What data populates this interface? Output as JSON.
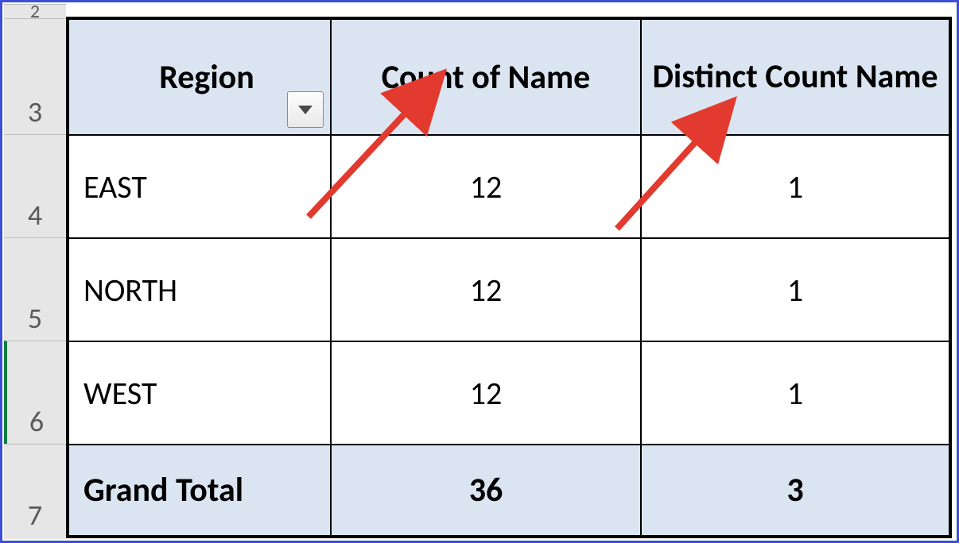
{
  "row_headers": {
    "r2": "2",
    "r3": "3",
    "r4": "4",
    "r5": "5",
    "r6": "6",
    "r7": "7"
  },
  "pivot": {
    "columns": {
      "col1": "Region",
      "col2": "Count of Name",
      "col3": "Distinct Count Name"
    },
    "rows": [
      {
        "region": "EAST",
        "count": "12",
        "distinct": "1"
      },
      {
        "region": "NORTH",
        "count": "12",
        "distinct": "1"
      },
      {
        "region": "WEST",
        "count": "12",
        "distinct": "1"
      }
    ],
    "total": {
      "label": "Grand Total",
      "count": "36",
      "distinct": "3"
    }
  },
  "chart_data": {
    "type": "table",
    "columns": [
      "Region",
      "Count of Name",
      "Distinct Count Name"
    ],
    "rows": [
      [
        "EAST",
        12,
        1
      ],
      [
        "NORTH",
        12,
        1
      ],
      [
        "WEST",
        12,
        1
      ]
    ],
    "grand_total": [
      "Grand Total",
      36,
      3
    ]
  }
}
